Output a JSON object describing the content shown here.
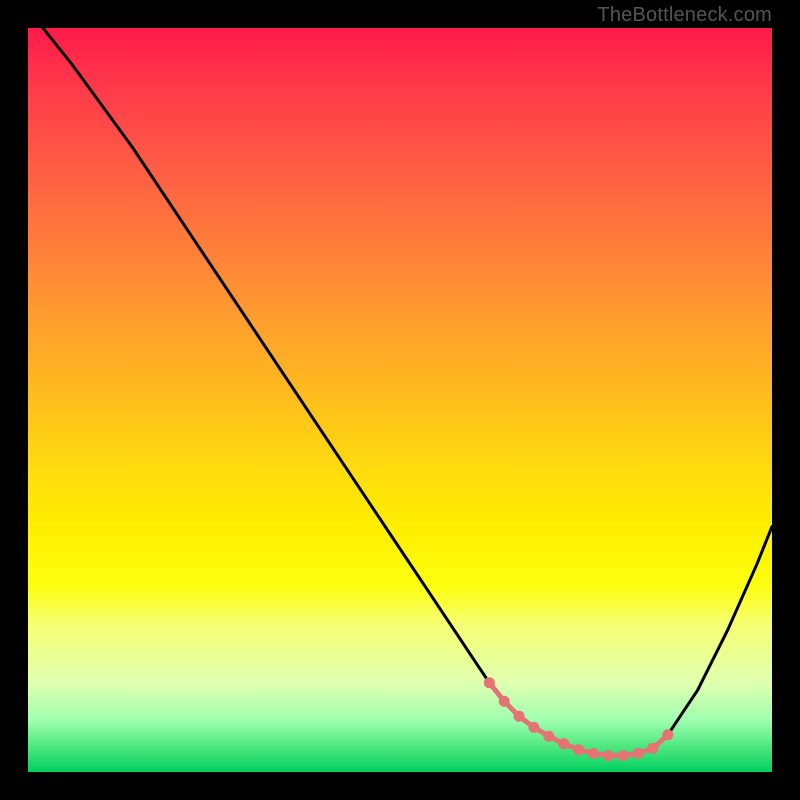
{
  "watermark": "TheBottleneck.com",
  "chart_data": {
    "type": "line",
    "title": "",
    "xlabel": "",
    "ylabel": "",
    "xlim": [
      0,
      100
    ],
    "ylim": [
      0,
      100
    ],
    "grid": false,
    "series": [
      {
        "name": "curve",
        "color": "#000000",
        "x": [
          2,
          6,
          10,
          14,
          22,
          30,
          38,
          46,
          54,
          60,
          62,
          64,
          66,
          68,
          70,
          72,
          74,
          76,
          78,
          80,
          82,
          84,
          86,
          90,
          94,
          98,
          100
        ],
        "y": [
          100,
          95,
          89.5,
          84,
          72,
          60,
          48,
          36,
          24,
          15,
          12,
          9.5,
          7.5,
          6,
          4.8,
          3.8,
          3,
          2.5,
          2.2,
          2.2,
          2.5,
          3.2,
          5,
          11,
          19,
          28,
          33
        ]
      }
    ],
    "markers": {
      "name": "bottleneck-band",
      "color": "#e57373",
      "x": [
        62,
        64,
        66,
        68,
        70,
        72,
        74,
        76,
        78,
        80,
        82,
        84,
        86
      ],
      "y": [
        12,
        9.5,
        7.5,
        6,
        4.8,
        3.8,
        3,
        2.5,
        2.2,
        2.2,
        2.5,
        3.2,
        5
      ]
    },
    "background": "vertical-gradient-heatmap"
  }
}
